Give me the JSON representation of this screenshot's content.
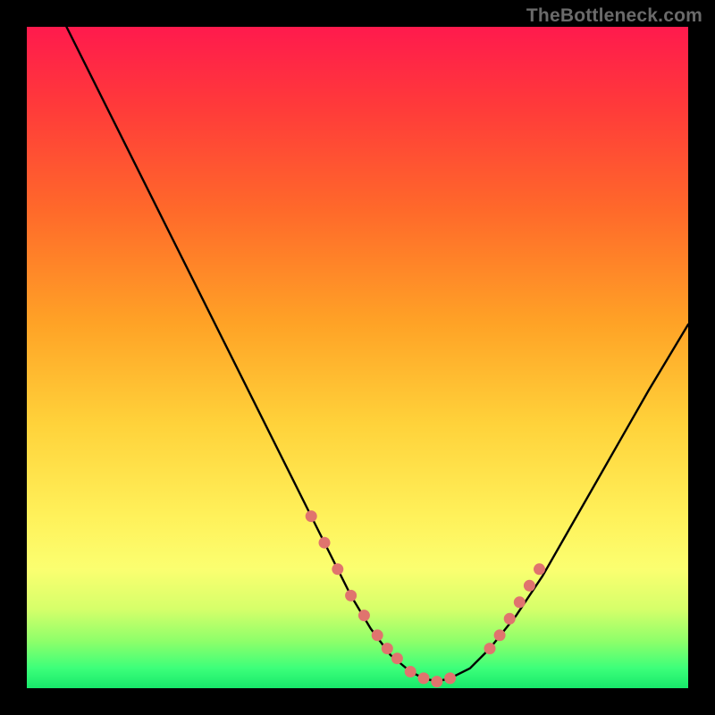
{
  "watermark": "TheBottleneck.com",
  "chart_data": {
    "type": "line",
    "title": "",
    "xlabel": "",
    "ylabel": "",
    "xlim": [
      0,
      100
    ],
    "ylim": [
      0,
      100
    ],
    "grid": false,
    "series": [
      {
        "name": "bottleneck-curve",
        "x": [
          6,
          10,
          15,
          20,
          25,
          30,
          35,
          40,
          43,
          46,
          49,
          52,
          55,
          58,
          60,
          62,
          64,
          67,
          70,
          74,
          78,
          82,
          86,
          90,
          94,
          100
        ],
        "y": [
          100,
          92,
          82,
          72,
          62,
          52,
          42,
          32,
          26,
          20,
          14,
          9,
          5,
          2.5,
          1.5,
          1,
          1.5,
          3,
          6,
          11,
          17,
          24,
          31,
          38,
          45,
          55
        ],
        "color": "#000000"
      }
    ],
    "markers": {
      "name": "highlight-dots",
      "color": "#e0746e",
      "x": [
        43,
        45,
        47,
        49,
        51,
        53,
        54.5,
        56,
        58,
        60,
        62,
        64,
        70,
        71.5,
        73,
        74.5,
        76,
        77.5
      ],
      "y": [
        26,
        22,
        18,
        14,
        11,
        8,
        6,
        4.5,
        2.5,
        1.5,
        1,
        1.5,
        6,
        8,
        10.5,
        13,
        15.5,
        18
      ]
    }
  }
}
